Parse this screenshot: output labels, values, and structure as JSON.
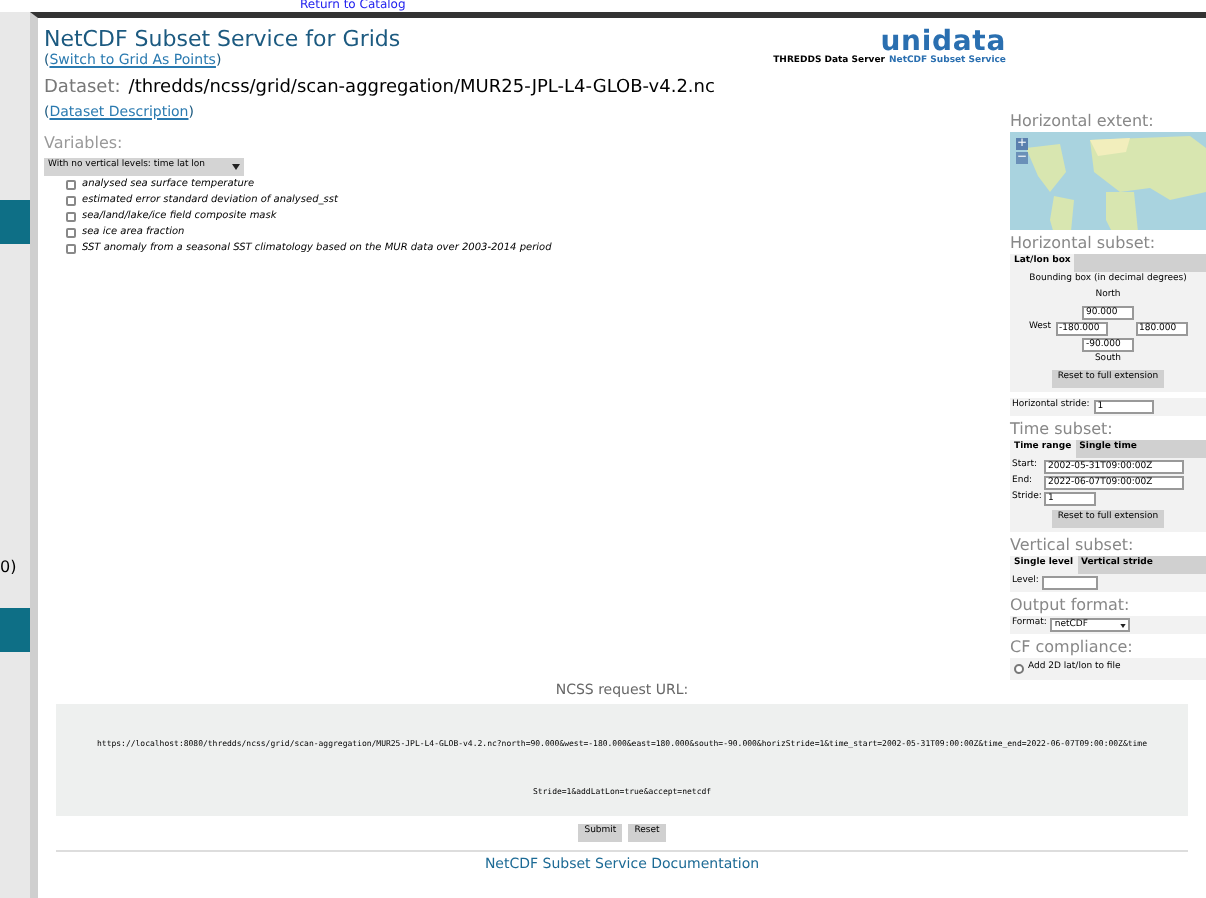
{
  "background_page": {
    "link": "Return to Catalog",
    "row_text": "0)"
  },
  "brackets": {
    "open": "(",
    "close": ")"
  },
  "header": {
    "title": "NetCDF Subset Service for Grids",
    "switch_link": "Switch to Grid As Points",
    "logo": "unidata",
    "logo_caption": "THREDDS Data Server",
    "logo_caption_link": "NetCDF Subset Service"
  },
  "dataset": {
    "label": "Dataset:",
    "path": "/thredds/ncss/grid/scan-aggregation/MUR25-JPL-L4-GLOB-v4.2.nc",
    "description_link": "Dataset Description"
  },
  "variables": {
    "label": "Variables:",
    "group": "With no vertical levels: time lat lon",
    "items": [
      {
        "label": "analysed sea surface temperature",
        "checked": false
      },
      {
        "label": "estimated error standard deviation of analysed_sst",
        "checked": false
      },
      {
        "label": "sea/land/lake/ice field composite mask",
        "checked": false
      },
      {
        "label": "sea ice area fraction",
        "checked": false
      },
      {
        "label": "SST anomaly from a seasonal SST climatology based on the MUR data over 2003-2014 period",
        "checked": false
      }
    ]
  },
  "horizontal_extent": {
    "label": "Horizontal extent:",
    "zoom_in": "+",
    "zoom_out": "−"
  },
  "horizontal_subset": {
    "label": "Horizontal subset:",
    "tabs": [
      {
        "label": "Lat/lon box",
        "selected": true
      }
    ],
    "bbox_label": "Bounding box (in decimal degrees)",
    "north_label": "North",
    "north": "90.000",
    "west_label": "West",
    "west": "-180.000",
    "east": "180.000",
    "south": "-90.000",
    "south_label": "South",
    "reset": "Reset to full extension"
  },
  "horizontal_stride": {
    "label": "Horizontal stride:",
    "value": "1"
  },
  "time_subset": {
    "label": "Time subset:",
    "tabs": [
      {
        "label": "Time range",
        "selected": true
      },
      {
        "label": "Single time",
        "selected": false
      }
    ],
    "start_label": "Start:",
    "start": "2002-05-31T09:00:00Z",
    "end_label": "End:",
    "end": "2022-06-07T09:00:00Z",
    "stride_label": "Stride:",
    "stride": "1",
    "reset": "Reset to full extension"
  },
  "vertical_subset": {
    "label": "Vertical subset:",
    "tabs": [
      {
        "label": "Single level",
        "selected": true
      },
      {
        "label": "Vertical stride",
        "selected": false
      }
    ],
    "level_label": "Level:"
  },
  "output_format": {
    "label": "Output format:",
    "format_label": "Format:",
    "value": "netCDF"
  },
  "cf_compliance": {
    "label": "CF compliance:",
    "option": "Add 2D lat/lon to file",
    "checked": false
  },
  "request": {
    "label": "NCSS request URL:",
    "url": "https://localhost:8080/thredds/ncss/grid/scan-aggregation/MUR25-JPL-L4-GLOB-v4.2.nc?north=90.000&west=-180.000&east=180.000&south=-90.000&horizStride=1&time_start=2002-05-31T09:00:00Z&time_end=2022-06-07T09:00:00Z&timeStride=1&addLatLon=true&accept=netcdf",
    "submit": "Submit",
    "reset": "Reset"
  },
  "footer_link": "NetCDF Subset Service Documentation"
}
